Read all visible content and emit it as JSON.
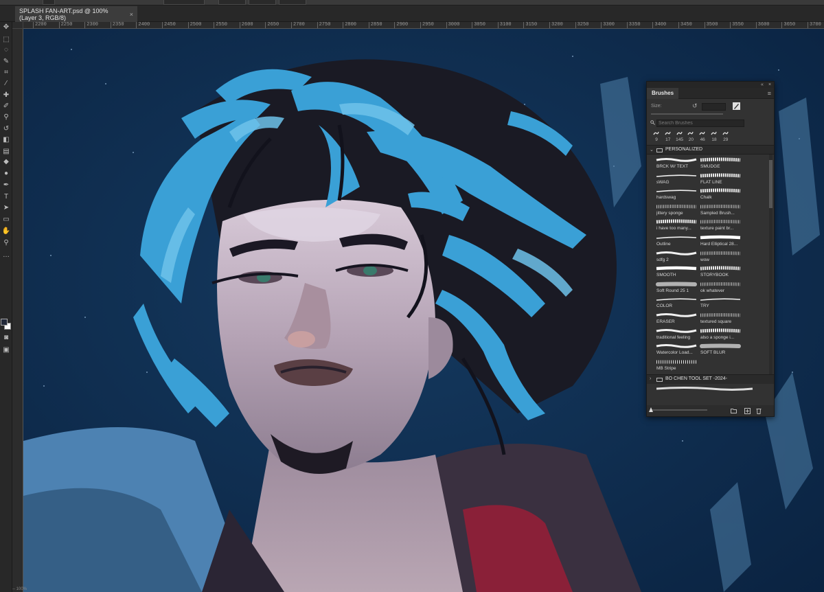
{
  "document": {
    "tab_title": "SPLASH FAN-ART.psd @ 100% (Layer 3, RGB/8)",
    "tab_close": "×",
    "status": "-- 100%"
  },
  "ruler": {
    "ticks": [
      "2200",
      "2250",
      "2300",
      "2350",
      "2400",
      "2450",
      "2500",
      "2550",
      "2600",
      "2650",
      "2700",
      "2750",
      "2800",
      "2850",
      "2900",
      "2950",
      "3000",
      "3050",
      "3100",
      "3150",
      "3200",
      "3250",
      "3300",
      "3350",
      "3400",
      "3450",
      "3500",
      "3550",
      "3600",
      "3650",
      "3700",
      "3750"
    ]
  },
  "tools": [
    {
      "name": "move-tool-icon",
      "glyph": "✥"
    },
    {
      "name": "marquee-tool-icon",
      "glyph": "⬚"
    },
    {
      "name": "lasso-tool-icon",
      "glyph": "◌"
    },
    {
      "name": "quick-select-tool-icon",
      "glyph": "✎"
    },
    {
      "name": "crop-tool-icon",
      "glyph": "⌗"
    },
    {
      "name": "eyedropper-tool-icon",
      "glyph": "⁄"
    },
    {
      "name": "healing-brush-tool-icon",
      "glyph": "✚"
    },
    {
      "name": "brush-tool-icon",
      "glyph": "✐"
    },
    {
      "name": "clone-stamp-tool-icon",
      "glyph": "⚲"
    },
    {
      "name": "history-brush-tool-icon",
      "glyph": "↺"
    },
    {
      "name": "eraser-tool-icon",
      "glyph": "◧"
    },
    {
      "name": "gradient-tool-icon",
      "glyph": "▤"
    },
    {
      "name": "blur-tool-icon",
      "glyph": "◆"
    },
    {
      "name": "dodge-tool-icon",
      "glyph": "●"
    },
    {
      "name": "pen-tool-icon",
      "glyph": "✒"
    },
    {
      "name": "type-tool-icon",
      "glyph": "T"
    },
    {
      "name": "path-select-tool-icon",
      "glyph": "➤"
    },
    {
      "name": "rectangle-tool-icon",
      "glyph": "▭"
    },
    {
      "name": "hand-tool-icon",
      "glyph": "✋"
    },
    {
      "name": "zoom-tool-icon",
      "glyph": "⚲"
    },
    {
      "name": "more-tools-icon",
      "glyph": "…"
    }
  ],
  "brushes_panel": {
    "title": "Brushes",
    "collapse_icon": "«",
    "close_icon": "×",
    "menu_icon": "≡",
    "size_label": "Size:",
    "size_value": "",
    "search_placeholder": "Search Brushes",
    "recent_brushes": [
      {
        "size": "9"
      },
      {
        "size": "17"
      },
      {
        "size": "145"
      },
      {
        "size": "20"
      },
      {
        "size": "46"
      },
      {
        "size": "18"
      },
      {
        "size": "29"
      }
    ],
    "groups": [
      {
        "label": "PERSONALIZED",
        "expanded": true
      },
      {
        "label": "BO CHEN TOOL SET -2024-",
        "expanded": false
      }
    ],
    "brushes": [
      {
        "name": "BRCK W/ TEXT",
        "stroke": "wave"
      },
      {
        "name": "SMUDGE",
        "stroke": "rough"
      },
      {
        "name": "sWAG",
        "stroke": "thin"
      },
      {
        "name": "FLAT LINE",
        "stroke": "rough"
      },
      {
        "name": "hardswag",
        "stroke": "thin"
      },
      {
        "name": "Chalk",
        "stroke": "rough"
      },
      {
        "name": "jittery sponge",
        "stroke": "grain"
      },
      {
        "name": "Sampled Brush...",
        "stroke": "grain"
      },
      {
        "name": "i have too many...",
        "stroke": "rough"
      },
      {
        "name": "texture paint br...",
        "stroke": "grain"
      },
      {
        "name": "Outline",
        "stroke": "thin"
      },
      {
        "name": "Hard  Elliptical 28...",
        "stroke": "solid"
      },
      {
        "name": "sdfg 2",
        "stroke": "wave"
      },
      {
        "name": "wow",
        "stroke": "grain"
      },
      {
        "name": "SMOOTH",
        "stroke": "solid"
      },
      {
        "name": "STORYBOOK",
        "stroke": "rough"
      },
      {
        "name": "Soft Round 25 1",
        "stroke": "soft"
      },
      {
        "name": "ok whatever",
        "stroke": "grain"
      },
      {
        "name": "COLOR",
        "stroke": "thin"
      },
      {
        "name": "TRY",
        "stroke": "thin"
      },
      {
        "name": "ERASER",
        "stroke": "wave"
      },
      {
        "name": "textured square",
        "stroke": "grain"
      },
      {
        "name": "traditional feeling",
        "stroke": "wave"
      },
      {
        "name": "also a sponge i...",
        "stroke": "rough"
      },
      {
        "name": "Watercolor  Load...",
        "stroke": "wave"
      },
      {
        "name": "SOFT BLUR",
        "stroke": "soft"
      },
      {
        "name": "MB Stripe",
        "stroke": "dash"
      }
    ]
  },
  "colors": {
    "panel_bg": "#323232",
    "canvas_bg": "#0f2a47",
    "hair_blue": "#3aa0d6",
    "skin": "#b7a6b6"
  }
}
